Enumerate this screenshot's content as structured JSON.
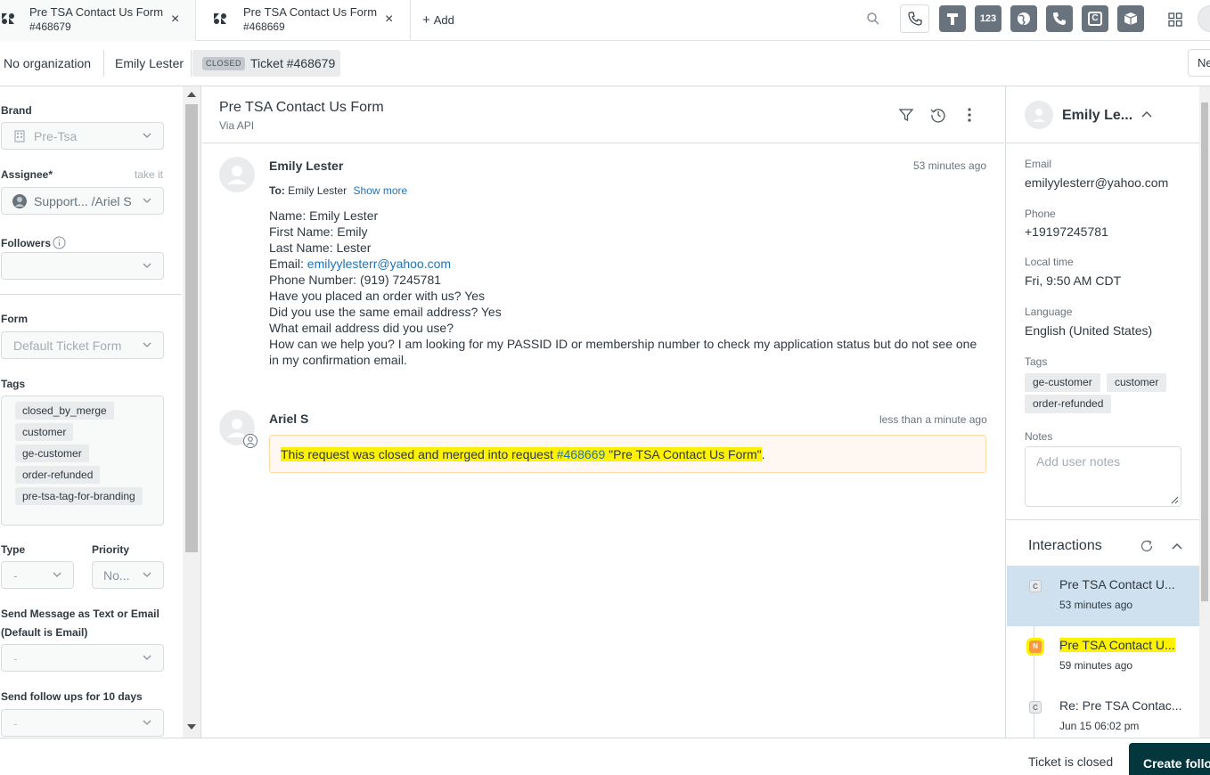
{
  "tabs": [
    {
      "title": "Pre TSA Contact Us Form",
      "id": "#468679"
    },
    {
      "title": "Pre TSA Contact Us Form",
      "id": "#468669"
    }
  ],
  "tab_close": "×",
  "add_label": "Add",
  "app_icons": [
    "phone-icon",
    "text-t-icon",
    "123",
    "globe-icon",
    "phone-filled-icon",
    "c-icon",
    "box-icon",
    "grid-icon"
  ],
  "app_icon_123": "123",
  "app_icon_c": "C",
  "breadcrumb": {
    "organization": "No organization",
    "requester": "Emily Lester",
    "status_badge": "CLOSED",
    "ticket": "Ticket #468679",
    "right_button": "Ne"
  },
  "left": {
    "brand_label": "Brand",
    "brand_value": "Pre-Tsa",
    "assignee_label": "Assignee*",
    "take_it": "take it",
    "assignee_value": "Support... /Ariel S",
    "followers_label": "Followers",
    "form_label": "Form",
    "form_value": "Default Ticket Form",
    "tags_label": "Tags",
    "tags": [
      "closed_by_merge",
      "customer",
      "ge-customer",
      "order-refunded",
      "pre-tsa-tag-for-branding"
    ],
    "type_label": "Type",
    "type_value": "-",
    "priority_label": "Priority",
    "priority_value": "No...",
    "send_message_label_1": "Send Message as Text or Email",
    "send_message_label_2": "(Default is Email)",
    "send_message_value": "-",
    "followups_label": "Send follow ups for 10 days",
    "followups_value": "-"
  },
  "conversation": {
    "title": "Pre TSA Contact Us Form",
    "via": "Via API",
    "messages": [
      {
        "author": "Emily Lester",
        "time": "53 minutes ago",
        "to_label": "To:",
        "to_name": "Emily Lester",
        "show_more": "Show more",
        "lines": [
          "Name: Emily Lester",
          "First Name: Emily",
          "Last Name: Lester",
          "Phone Number: (919) 7245781",
          "Have you placed an order with us? Yes",
          "Did you use the same email address? Yes",
          "What email address did you use?",
          "How can we help you? I am looking for my PASSID ID or membership number to check my application status but do not see one",
          "in my confirmation email."
        ],
        "email_label": "Email:",
        "email_value": "emilyylesterr@yahoo.com"
      },
      {
        "author": "Ariel S",
        "time": "less than a minute ago",
        "merge_prefix": "This request was closed and merged into request ",
        "merge_link": "#468669",
        "merge_suffix": " \"Pre TSA Contact Us Form\"",
        "merge_end": "."
      }
    ]
  },
  "right": {
    "user_name": "Emily Le...",
    "email_label": "Email",
    "email_value": "emilyylesterr@yahoo.com",
    "phone_label": "Phone",
    "phone_value": "+19197245781",
    "local_time_label": "Local time",
    "local_time_value": "Fri, 9:50 AM CDT",
    "language_label": "Language",
    "language_value": "English (United States)",
    "tags_label": "Tags",
    "tags": [
      "ge-customer",
      "customer",
      "order-refunded"
    ],
    "notes_label": "Notes",
    "notes_placeholder": "Add user notes",
    "interactions_label": "Interactions",
    "interactions": [
      {
        "badge": "C",
        "title": "Pre TSA Contact U...",
        "time": "53 minutes ago"
      },
      {
        "badge": "N",
        "title": "Pre TSA Contact U...",
        "time": "59 minutes ago"
      },
      {
        "badge": "C",
        "title": "Re: Pre TSA Contac...",
        "time": "Jun 15 06:02 pm"
      }
    ]
  },
  "footer": {
    "status_text": "Ticket is closed",
    "create_followup": "Create follow"
  },
  "colors": {
    "link": "#1f73b7",
    "highlight": "#fff200",
    "selected_interaction": "#cfe1ef",
    "primary_button": "#03363d"
  }
}
